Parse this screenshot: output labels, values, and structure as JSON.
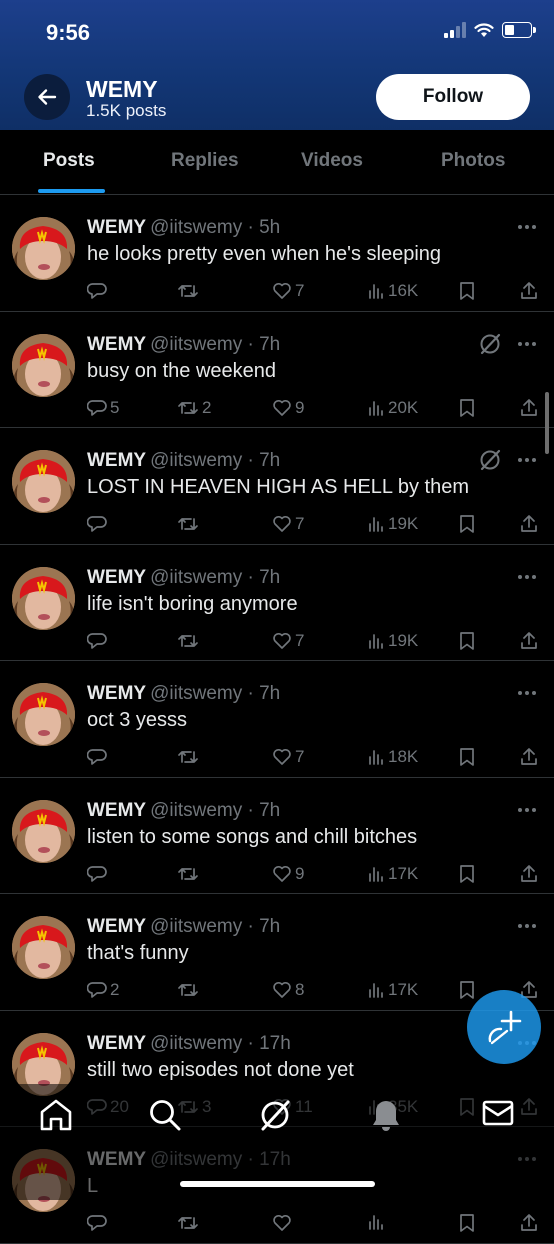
{
  "status_bar": {
    "time": "9:56"
  },
  "header": {
    "title": "WEMY",
    "subtitle": "1.5K posts",
    "follow_label": "Follow"
  },
  "tabs": [
    {
      "label": "Posts",
      "active": true
    },
    {
      "label": "Replies",
      "active": false
    },
    {
      "label": "Videos",
      "active": false
    },
    {
      "label": "Photos",
      "active": false
    }
  ],
  "tweets": [
    {
      "name": "WEMY",
      "handle": "@iitswemy",
      "time": "5h",
      "text": "he looks pretty even when he's sleeping",
      "replies": "",
      "reposts": "",
      "likes": "7",
      "views": "16K",
      "grok": false
    },
    {
      "name": "WEMY",
      "handle": "@iitswemy",
      "time": "7h",
      "text": "busy on the weekend",
      "replies": "5",
      "reposts": "2",
      "likes": "9",
      "views": "20K",
      "grok": true
    },
    {
      "name": "WEMY",
      "handle": "@iitswemy",
      "time": "7h",
      "text": "LOST IN HEAVEN HIGH AS HELL by them",
      "replies": "",
      "reposts": "",
      "likes": "7",
      "views": "19K",
      "grok": true
    },
    {
      "name": "WEMY",
      "handle": "@iitswemy",
      "time": "7h",
      "text": "life isn't boring anymore",
      "replies": "",
      "reposts": "",
      "likes": "7",
      "views": "19K",
      "grok": false
    },
    {
      "name": "WEMY",
      "handle": "@iitswemy",
      "time": "7h",
      "text": "oct 3 yesss",
      "replies": "",
      "reposts": "",
      "likes": "7",
      "views": "18K",
      "grok": false
    },
    {
      "name": "WEMY",
      "handle": "@iitswemy",
      "time": "7h",
      "text": "listen to some songs and chill bitches",
      "replies": "",
      "reposts": "",
      "likes": "9",
      "views": "17K",
      "grok": false
    },
    {
      "name": "WEMY",
      "handle": "@iitswemy",
      "time": "7h",
      "text": "that's funny",
      "replies": "2",
      "reposts": "",
      "likes": "8",
      "views": "17K",
      "grok": false
    },
    {
      "name": "WEMY",
      "handle": "@iitswemy",
      "time": "17h",
      "text": "still two episodes not done yet",
      "replies": "20",
      "reposts": "3",
      "likes": "11",
      "views": "35K",
      "grok": false
    },
    {
      "name": "WEMY",
      "handle": "@iitswemy",
      "time": "17h",
      "text": "L",
      "replies": "",
      "reposts": "",
      "likes": "",
      "views": "",
      "grok": false
    }
  ],
  "icons": {
    "back": "arrow-left-icon",
    "reply": "reply-icon",
    "repost": "repost-icon",
    "like": "heart-icon",
    "views": "views-icon",
    "bookmark": "bookmark-icon",
    "share": "share-icon",
    "more": "more-icon",
    "grok": "grok-icon",
    "home": "home-icon",
    "search": "search-icon",
    "notifications": "bell-icon",
    "messages": "mail-icon",
    "compose": "compose-icon"
  },
  "colors": {
    "accent": "#1d9bf0",
    "header_bg": "#143a7a",
    "muted": "#71767b",
    "text": "#e7e9ea"
  }
}
